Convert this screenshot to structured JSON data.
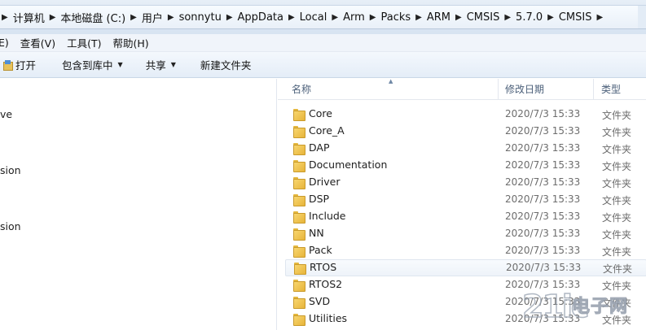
{
  "address": {
    "crumbs": [
      "计算机",
      "本地磁盘 (C:)",
      "用户",
      "sonnytu",
      "AppData",
      "Local",
      "Arm",
      "Packs",
      "ARM",
      "CMSIS",
      "5.7.0",
      "CMSIS"
    ]
  },
  "menu": {
    "items": [
      "E)",
      "查看(V)",
      "工具(T)",
      "帮助(H)"
    ]
  },
  "toolbar": {
    "open_label": "打开",
    "include_label": "包含到库中",
    "share_label": "共享",
    "newfolder_label": "新建文件夹"
  },
  "nav": {
    "items": [
      "ve",
      "sion",
      "sion"
    ]
  },
  "columns": {
    "name": "名称",
    "date": "修改日期",
    "type": "类型"
  },
  "files": [
    {
      "name": "Core",
      "date": "2020/7/3 15:33",
      "type": "文件夹"
    },
    {
      "name": "Core_A",
      "date": "2020/7/3 15:33",
      "type": "文件夹"
    },
    {
      "name": "DAP",
      "date": "2020/7/3 15:33",
      "type": "文件夹"
    },
    {
      "name": "Documentation",
      "date": "2020/7/3 15:33",
      "type": "文件夹"
    },
    {
      "name": "Driver",
      "date": "2020/7/3 15:33",
      "type": "文件夹"
    },
    {
      "name": "DSP",
      "date": "2020/7/3 15:33",
      "type": "文件夹"
    },
    {
      "name": "Include",
      "date": "2020/7/3 15:33",
      "type": "文件夹"
    },
    {
      "name": "NN",
      "date": "2020/7/3 15:33",
      "type": "文件夹"
    },
    {
      "name": "Pack",
      "date": "2020/7/3 15:33",
      "type": "文件夹"
    },
    {
      "name": "RTOS",
      "date": "2020/7/3 15:33",
      "type": "文件夹"
    },
    {
      "name": "RTOS2",
      "date": "2020/7/3 15:33",
      "type": "文件夹"
    },
    {
      "name": "SVD",
      "date": "2020/7/3 15:33",
      "type": "文件夹"
    },
    {
      "name": "Utilities",
      "date": "2020/7/3 15:33",
      "type": "文件夹"
    }
  ],
  "watermark": {
    "logo": "21ic",
    "text": "电子网"
  }
}
